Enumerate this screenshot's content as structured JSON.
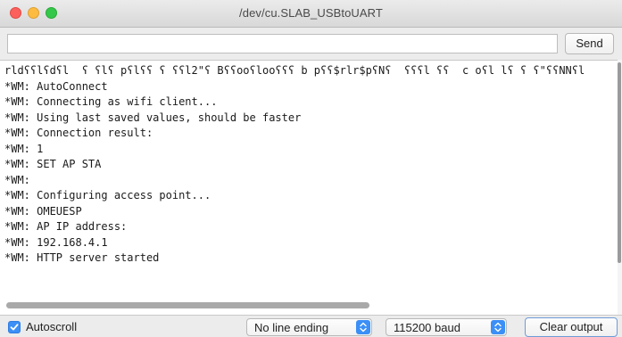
{
  "window": {
    "title": "/dev/cu.SLAB_USBtoUART"
  },
  "send": {
    "input_value": "",
    "button_label": "Send"
  },
  "output": {
    "lines": [
      "rldʕʕlʕdʕl  ʕ ʕlʕ pʕlʕʕ ʕ ʕʕl2\"ʕ Bʕʕooʕlooʕʕʕ b pʕʕ$rlr$pʕNʕ  ʕʕʕl ʕʕ  c oʕl lʕ ʕ ʕ\"ʕʕNNʕl",
      "*WM: AutoConnect",
      "*WM: Connecting as wifi client...",
      "*WM: Using last saved values, should be faster",
      "*WM: Connection result:",
      "*WM: 1",
      "*WM: SET AP STA",
      "*WM:",
      "*WM: Configuring access point...",
      "*WM: OMEUESP",
      "*WM: AP IP address:",
      "*WM: 192.168.4.1",
      "*WM: HTTP server started"
    ]
  },
  "bottom": {
    "autoscroll_label": "Autoscroll",
    "autoscroll_checked": true,
    "line_ending": "No line ending",
    "baud": "115200 baud",
    "clear_label": "Clear output"
  },
  "colors": {
    "accent": "#3b8ff6",
    "close": "#fc605c",
    "minimize": "#fdbc40",
    "zoom": "#34c84a"
  },
  "icons": {
    "close": "close-dot-icon",
    "minimize": "minimize-dot-icon",
    "zoom": "zoom-dot-icon",
    "checkbox": "checkmark-icon",
    "stepper": "updown-chevron-icon"
  }
}
